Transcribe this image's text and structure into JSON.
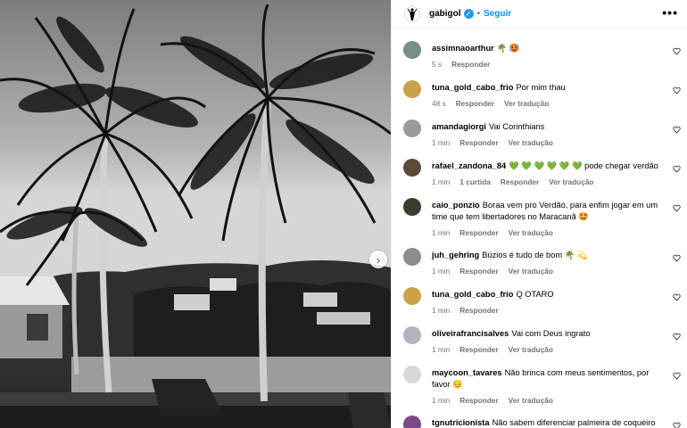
{
  "post": {
    "author": "gabigol",
    "separator": "•",
    "follow_label": "Seguir",
    "more_label": "•••",
    "carousel_next": "›"
  },
  "comments": [
    {
      "user": "assimnaoarthur",
      "text": "🌴 🥵",
      "time": "5 s",
      "actions": [
        "Responder"
      ],
      "avatar_color": "#7a8f84"
    },
    {
      "user": "tuna_gold_cabo_frio",
      "text": "Por mim thau",
      "time": "48 s",
      "actions": [
        "Responder",
        "Ver tradução"
      ],
      "avatar_color": "#c9a24a"
    },
    {
      "user": "amandagiorgi",
      "text": "Vai Corinthians",
      "time": "1 min",
      "actions": [
        "Responder",
        "Ver tradução"
      ],
      "avatar_color": "#9a9a9a"
    },
    {
      "user": "rafael_zandona_84",
      "text": "💚 💚 💚 💚 💚 💚  pode chegar verdão",
      "time": "1 min",
      "actions": [
        "1 curtida",
        "Responder",
        "Ver tradução"
      ],
      "avatar_color": "#5a4a3a"
    },
    {
      "user": "caio_ponzio",
      "text": "Boraa vem pro Verdão, para enfim jogar em um time que tem libertadores no Maracanã 🤩",
      "time": "1 min",
      "actions": [
        "Responder",
        "Ver tradução"
      ],
      "avatar_color": "#3b3b2e"
    },
    {
      "user": "juh_gehring",
      "text": "Búzios é tudo de bom 🌴 💫",
      "time": "1 min",
      "actions": [
        "Responder",
        "Ver tradução"
      ],
      "avatar_color": "#8c8c8c"
    },
    {
      "user": "tuna_gold_cabo_frio",
      "text": "Q OTARO",
      "time": "1 min",
      "actions": [
        "Responder"
      ],
      "avatar_color": "#c9a24a"
    },
    {
      "user": "oliveirafrancisalves",
      "text": "Vai com Deus ingrato",
      "time": "1 min",
      "actions": [
        "Responder",
        "Ver tradução"
      ],
      "avatar_color": "#b0b4bc"
    },
    {
      "user": "maycoon_tavares",
      "text": "Não brinca com meus sentimentos, por favor 😔",
      "time": "1 min",
      "actions": [
        "Responder",
        "Ver tradução"
      ],
      "avatar_color": "#d8d8d8"
    },
    {
      "user": "tgnutricionista",
      "text": "Não sabem diferenciar palmeira de coqueiro ??",
      "time": "",
      "actions": [],
      "avatar_color": "#7b4a8c"
    }
  ],
  "colors": {
    "accent": "#0095f6",
    "verified": "#1d9bf0",
    "meta_text": "#737373"
  },
  "icons": {
    "author_avatar": "silhouette-icon",
    "verified": "verified-badge-icon",
    "like": "heart-outline-icon",
    "more": "more-horizontal-icon",
    "next": "chevron-right-icon"
  }
}
